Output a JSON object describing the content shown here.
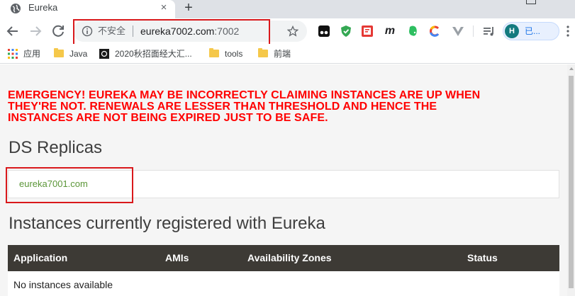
{
  "window": {
    "tab_title": "Eureka",
    "tab_close": "×",
    "new_tab": "+"
  },
  "toolbar": {
    "security_label": "不安全",
    "url_host": "eureka7002.com",
    "url_port": ":7002",
    "profile_initial": "H",
    "profile_label": "已..."
  },
  "extensions": {
    "m_label": "m"
  },
  "bookmarks": [
    {
      "label": "应用"
    },
    {
      "label": "Java"
    },
    {
      "label": "2020秋招面经大汇..."
    },
    {
      "label": "tools"
    },
    {
      "label": "前端"
    }
  ],
  "page": {
    "emergency_lines": [
      "EMERGENCY! EUREKA MAY BE INCORRECTLY CLAIMING INSTANCES ARE UP WHEN",
      "THEY'RE NOT. RENEWALS ARE LESSER THAN THRESHOLD AND HENCE THE",
      "INSTANCES ARE NOT BEING EXPIRED JUST TO BE SAFE."
    ],
    "replicas_heading": "DS Replicas",
    "replica_link": "eureka7001.com",
    "instances_heading": "Instances currently registered with Eureka",
    "table": {
      "headers": [
        "Application",
        "AMIs",
        "Availability Zones",
        "Status"
      ],
      "empty_message": "No instances available"
    }
  },
  "colors": {
    "emergency_red": "#ff0000",
    "annotation_red": "#d9191c",
    "table_header_bg": "#3d3a35",
    "link_green": "#5b9638",
    "page_bg": "#f5f5f5"
  },
  "icons": {
    "tab_favicon": "globe-icon",
    "back": "back-arrow-icon",
    "forward": "forward-arrow-icon",
    "reload": "reload-icon",
    "info": "info-icon",
    "star": "star-icon",
    "apps": "apps-grid-icon",
    "folder": "folder-icon",
    "menu": "more-vert-icon"
  }
}
